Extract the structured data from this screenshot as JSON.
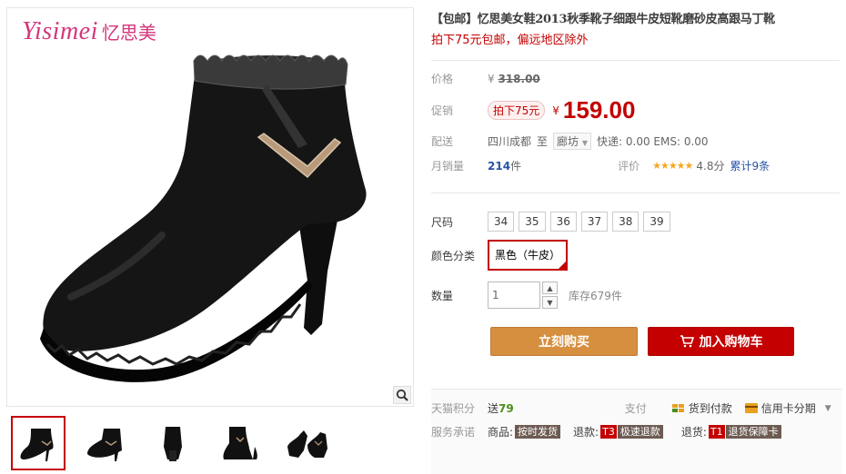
{
  "brand": {
    "logo_en": "Yisimei",
    "logo_cn": "忆思美"
  },
  "product": {
    "title": "【包邮】忆思美女鞋2013秋季靴子细跟牛皮短靴磨砂皮高跟马丁靴",
    "subtitle": "拍下75元包邮，偏远地区除外"
  },
  "price": {
    "label": "价格",
    "yen": "¥",
    "original": "318.00",
    "promo_label": "促销",
    "promo_tag": "拍下75元",
    "current": "159.00"
  },
  "shipping": {
    "label": "配送",
    "from": "四川成都",
    "to_word": "至",
    "to_city": "廊坊",
    "fees": "快递: 0.00 EMS: 0.00"
  },
  "sales": {
    "label": "月销量",
    "count": "214",
    "unit": "件",
    "rating_label": "评价",
    "stars": "★★★★★",
    "rating": "4.8分",
    "reviews": "累计9条"
  },
  "size": {
    "label": "尺码",
    "options": [
      "34",
      "35",
      "36",
      "37",
      "38",
      "39"
    ]
  },
  "color": {
    "label": "颜色分类",
    "selected": "黑色（牛皮）"
  },
  "quantity": {
    "label": "数量",
    "value": "1",
    "stock": "库存679件"
  },
  "actions": {
    "buy_now": "立刻购买",
    "add_to_cart": "加入购物车"
  },
  "points": {
    "label": "天猫积分",
    "text": "送",
    "value": "79",
    "pay_label": "支付",
    "cod": "货到付款",
    "credit": "信用卡分期"
  },
  "service": {
    "label": "服务承诺",
    "goods_prefix": "商品:",
    "goods_tag": "按时发货",
    "refund_prefix": "退款:",
    "refund_code": "T3",
    "refund_tag": "极速退款",
    "return_prefix": "退货:",
    "return_code": "T1",
    "return_tag": "退货保障卡"
  },
  "colors": {
    "accent": "#c40000",
    "buy": "#d68f3f",
    "brand": "#d4367b"
  }
}
